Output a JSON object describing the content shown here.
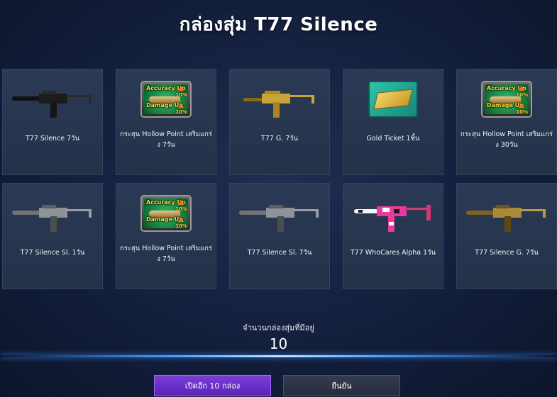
{
  "title": "กล่องสุ่ม T77 Silence",
  "items": [
    {
      "label": "T77 Silence 7วัน",
      "icon": "smg-black-icon",
      "colors": {
        "body": "#1c1c1c",
        "accent": "#3a3a3a"
      }
    },
    {
      "label": "กระสุน Hollow Point เสริมแกร่ง 7วัน",
      "icon": "hollow-point-badge-icon",
      "badge": {
        "line1": "Accuracy Up",
        "line2": "Damage Up",
        "pct1": "10%",
        "pct2": "10%"
      }
    },
    {
      "label": "T77 G. 7วัน",
      "icon": "smg-gold-icon",
      "colors": {
        "body": "#c9a437",
        "accent": "#8a6a14"
      }
    },
    {
      "label": "Gold Ticket 1ชิ้น",
      "icon": "gold-ticket-icon"
    },
    {
      "label": "กระสุน Hollow Point เสริมแกร่ง 30วัน",
      "icon": "hollow-point-badge-icon",
      "badge": {
        "line1": "Accuracy Up",
        "line2": "Damage Up",
        "pct1": "10%",
        "pct2": "10%"
      }
    },
    {
      "label": "T77 Silence Sl. 1วัน",
      "icon": "smg-silver-icon",
      "colors": {
        "body": "#8f9296",
        "accent": "#5b5e62"
      }
    },
    {
      "label": "กระสุน Hollow Point เสริมแกร่ง 7วัน",
      "icon": "hollow-point-badge-icon",
      "badge": {
        "line1": "Accuracy Up",
        "line2": "Damage Up",
        "pct1": "10%",
        "pct2": "10%"
      }
    },
    {
      "label": "T77 Silence Sl. 7วัน",
      "icon": "smg-silver-icon",
      "colors": {
        "body": "#8f9296",
        "accent": "#5b5e62"
      }
    },
    {
      "label": "T77 WhoCares Alpha 1วัน",
      "icon": "smg-pink-icon",
      "colors": {
        "body": "#e83b9a",
        "accent": "#f4f4f4"
      }
    },
    {
      "label": "T77 Silence G. 7วัน",
      "icon": "smg-gold-dark-icon",
      "colors": {
        "body": "#a88a3a",
        "accent": "#6b551c"
      }
    }
  ],
  "count_label": "จำนวนกล่องสุ่มที่มีอยู่",
  "count_value": "10",
  "buttons": {
    "open_ten": "เปิดอีก 10 กล่อง",
    "confirm": "ยืนยัน"
  },
  "accent_colors": {
    "open_button": "#6a30c8",
    "glow": "#3aa0ff"
  }
}
